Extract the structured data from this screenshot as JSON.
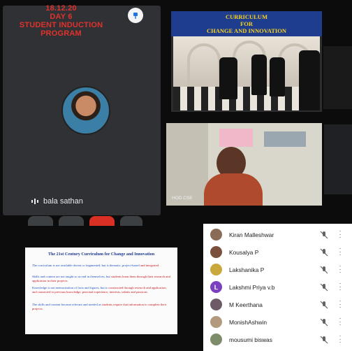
{
  "banner": {
    "date": "18.12.20",
    "day": "DAY 6",
    "program": "STUDENT INDUCTION PROGRAM"
  },
  "main_participant": {
    "name": "bala sathan"
  },
  "curriculum_slide": {
    "header_line1": "CURRICULUM",
    "header_line2": "FOR",
    "header_line3": "CHANGE AND INNOVATION"
  },
  "speaker_tile": {
    "label": "HOD CSE"
  },
  "presentation": {
    "title": "The 21st Century Curriculum for Change and Innovation",
    "bullets": [
      {
        "blue": "The curriculum is not available driven or fragmented, but is thematic, project-based",
        "red": "and integrated."
      },
      {
        "blue": "Skills and content are not taught so as end in themselves, but",
        "red": "students learn them through their research and application in their projects."
      },
      {
        "blue": "Knowledge is not memorization of facts and figures, but is",
        "red": "constructed through research and application, and connected to previous knowledge, personal experience, interests, talents and passions."
      },
      {
        "blue": "The skills and content become relevant and needed as",
        "red": "students require that information to complete their projects."
      }
    ]
  },
  "participants": [
    {
      "name": "Kiran Malleshwar",
      "initial": "",
      "color": "#8a6b55"
    },
    {
      "name": "Kousalya P",
      "initial": "",
      "color": "#7a4f3c"
    },
    {
      "name": "Lakshanika P",
      "initial": "",
      "color": "#caa83c"
    },
    {
      "name": "Lakshmi Priya v.b",
      "initial": "L",
      "color": "#7b3fbf"
    },
    {
      "name": "M Keerthana",
      "initial": "",
      "color": "#6d5a66"
    },
    {
      "name": "MonishAshwin",
      "initial": "",
      "color": "#b49a7c"
    },
    {
      "name": "mousumi biswas",
      "initial": "",
      "color": "#7d8c6a"
    }
  ],
  "icons": {
    "pin": "pin-icon",
    "mic_off": "mic-off-icon",
    "more": "more-vert-icon",
    "audio": "audio-level-icon"
  }
}
